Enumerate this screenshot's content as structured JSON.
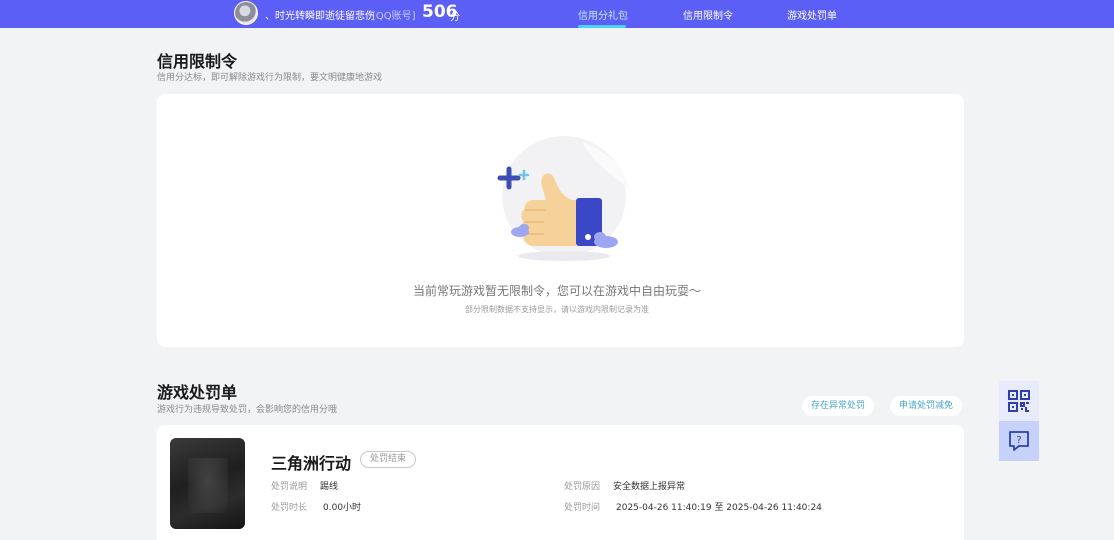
{
  "topbar": {
    "username": "、时光转瞬即逝徒留悲伤",
    "account_tag": "[QQ账号]",
    "score": "506",
    "score_unit": "分",
    "tabs": [
      {
        "label": "信用分礼包",
        "active": true
      },
      {
        "label": "信用限制令",
        "active": false
      },
      {
        "label": "游戏处罚单",
        "active": false
      }
    ]
  },
  "restriction": {
    "title": "信用限制令",
    "subtitle": "信用分达标，即可解除游戏行为限制，要文明健康地游戏",
    "empty_title": "当前常玩游戏暂无限制令，您可以在游戏中自由玩耍～",
    "empty_note": "部分限制数据不支持显示，请以游戏内限制记录为准"
  },
  "penalty": {
    "title": "游戏处罚单",
    "subtitle": "游戏行为违规导致处罚，会影响您的信用分哦",
    "appeal_button": "存在异常处罚",
    "reduce_button": "申请处罚减免",
    "items": [
      {
        "game": "三角洲行动",
        "status": "处罚结束",
        "desc_label": "处罚说明",
        "desc_value": "踢线",
        "duration_label": "处罚时长",
        "duration_value": "0.00小时",
        "reason_label": "处罚原因",
        "reason_value": "安全数据上报异常",
        "time_label": "处罚时间",
        "time_value": "2025-04-26 11:40:19 至 2025-04-26 11:40:24"
      }
    ]
  },
  "icons": {
    "qr": "qr-code-icon",
    "help": "help-chat-icon"
  },
  "colors": {
    "topbar": "#5b5ff5",
    "active_tab": "#bfe9ff",
    "pill_text": "#4aa6c8"
  }
}
